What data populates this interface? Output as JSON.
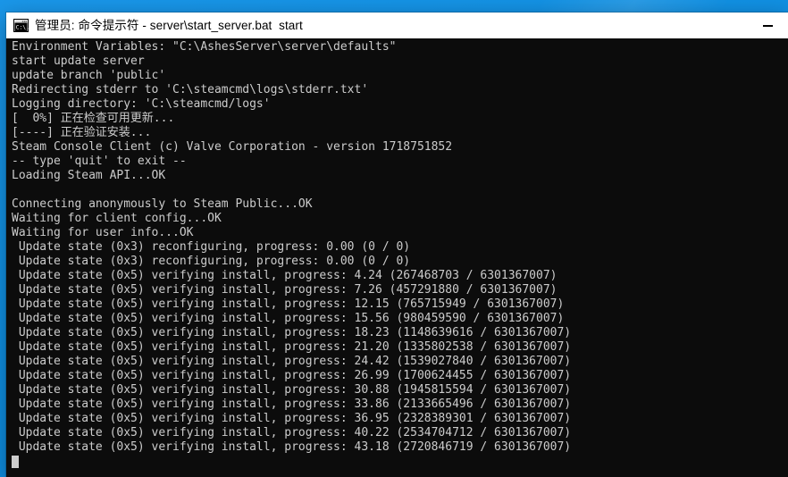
{
  "desktop": {
    "background_color": "#1593e6"
  },
  "window": {
    "title": "管理员: 命令提示符 - server\\start_server.bat  start",
    "icon": "cmd-console-icon",
    "titlebar_background": "#ffffff",
    "titlebar_text_color": "#000000",
    "controls": {
      "minimize_label": "—",
      "minimize_name": "minimize-button"
    }
  },
  "console": {
    "background_color": "#0c0c0c",
    "text_color": "#cccccc",
    "cursor": "block-cursor",
    "lines": [
      "Environment Variables: \"C:\\AshesServer\\server\\defaults\"",
      "start update server",
      "update branch 'public'",
      "Redirecting stderr to 'C:\\steamcmd\\logs\\stderr.txt'",
      "Logging directory: 'C:\\steamcmd/logs'",
      "[  0%] 正在检查可用更新...",
      "[----] 正在验证安装...",
      "Steam Console Client (c) Valve Corporation - version 1718751852",
      "-- type 'quit' to exit --",
      "Loading Steam API...OK",
      "",
      "Connecting anonymously to Steam Public...OK",
      "Waiting for client config...OK",
      "Waiting for user info...OK",
      " Update state (0x3) reconfiguring, progress: 0.00 (0 / 0)",
      " Update state (0x3) reconfiguring, progress: 0.00 (0 / 0)",
      " Update state (0x5) verifying install, progress: 4.24 (267468703 / 6301367007)",
      " Update state (0x5) verifying install, progress: 7.26 (457291880 / 6301367007)",
      " Update state (0x5) verifying install, progress: 12.15 (765715949 / 6301367007)",
      " Update state (0x5) verifying install, progress: 15.56 (980459590 / 6301367007)",
      " Update state (0x5) verifying install, progress: 18.23 (1148639616 / 6301367007)",
      " Update state (0x5) verifying install, progress: 21.20 (1335802538 / 6301367007)",
      " Update state (0x5) verifying install, progress: 24.42 (1539027840 / 6301367007)",
      " Update state (0x5) verifying install, progress: 26.99 (1700624455 / 6301367007)",
      " Update state (0x5) verifying install, progress: 30.88 (1945815594 / 6301367007)",
      " Update state (0x5) verifying install, progress: 33.86 (2133665496 / 6301367007)",
      " Update state (0x5) verifying install, progress: 36.95 (2328389301 / 6301367007)",
      " Update state (0x5) verifying install, progress: 40.22 (2534704712 / 6301367007)",
      " Update state (0x5) verifying install, progress: 43.18 (2720846719 / 6301367007)"
    ]
  }
}
